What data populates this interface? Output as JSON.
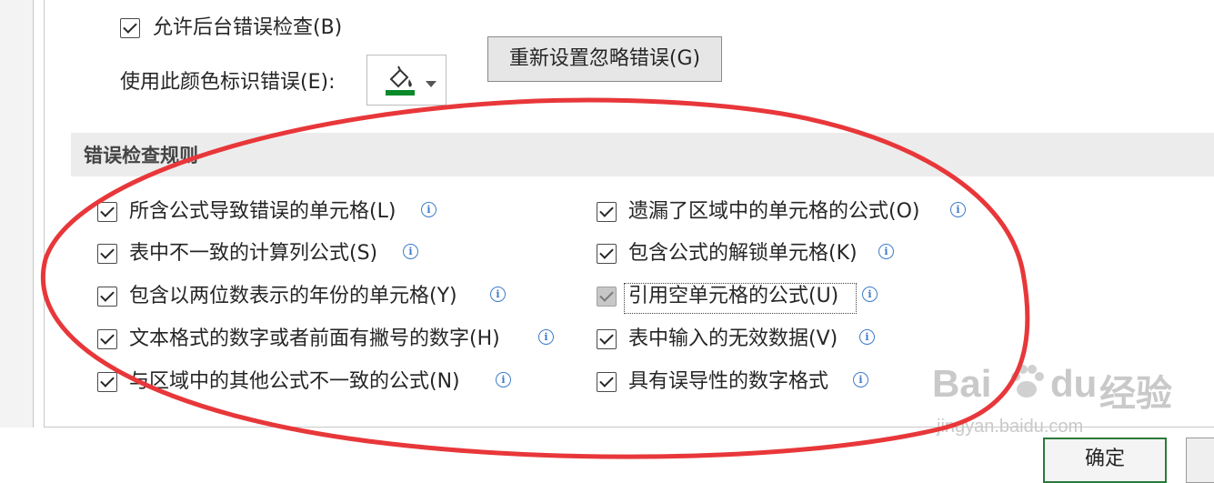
{
  "general": {
    "background_check_label": "允许后台错误检查(B)",
    "color_label": "使用此颜色标识错误(E):",
    "reset_button": "重新设置忽略错误(G)",
    "color_value": "#0a8a2a"
  },
  "section": {
    "title": "错误检查规则"
  },
  "rules_left": [
    {
      "label": "所含公式导致错误的单元格(L)",
      "checked": true
    },
    {
      "label": "表中不一致的计算列公式(S)",
      "checked": true
    },
    {
      "label": "包含以两位数表示的年份的单元格(Y)",
      "checked": true
    },
    {
      "label": "文本格式的数字或者前面有撇号的数字(H)",
      "checked": true
    },
    {
      "label": "与区域中的其他公式不一致的公式(N)",
      "checked": true
    }
  ],
  "rules_right": [
    {
      "label": "遗漏了区域中的单元格的公式(O)",
      "checked": true
    },
    {
      "label": "包含公式的解锁单元格(K)",
      "checked": true
    },
    {
      "label": "引用空单元格的公式(U)",
      "checked": true,
      "disabled": true
    },
    {
      "label": "表中输入的无效数据(V)",
      "checked": true
    },
    {
      "label": "具有误导性的数字格式",
      "checked": true
    }
  ],
  "footer": {
    "ok_button": "确定"
  },
  "annotation": {
    "ellipse_color": "#e8373a"
  },
  "watermark": {
    "brand": "Bai",
    "brand2": "du",
    "cn": "经验",
    "url": "jingyan.baidu.com"
  },
  "info_glyph": "i"
}
